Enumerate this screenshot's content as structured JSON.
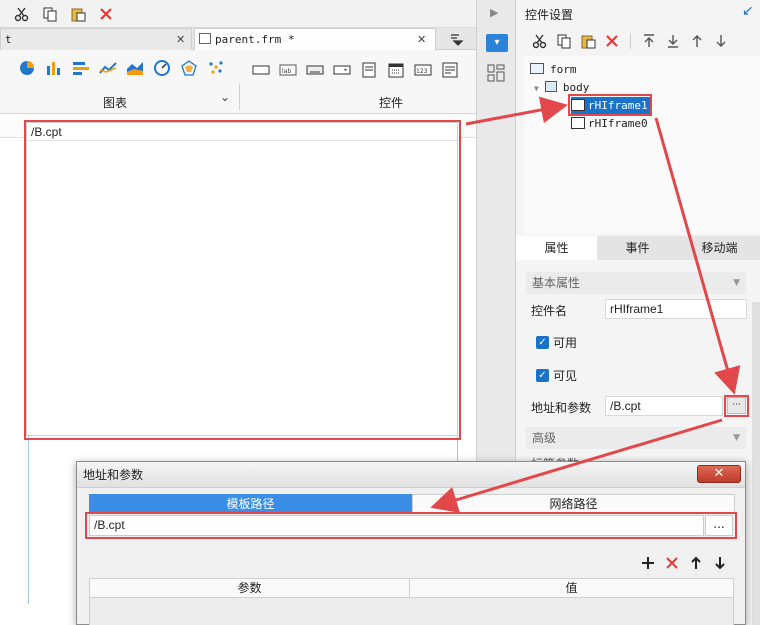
{
  "toolbar": {
    "icons": [
      "scissors-icon",
      "copy-icon",
      "paste-icon",
      "delete-icon"
    ],
    "colors": {
      "delete": "#e53935",
      "icon": "#333333"
    }
  },
  "tabs": [
    {
      "label": "t"
    },
    {
      "label": "parent.frm *"
    }
  ],
  "ribbon": {
    "chart_group_label": "图表",
    "widget_group_label": "控件",
    "widget_icons": [
      "textbox-icon",
      "label-icon",
      "button-icon",
      "combo-icon",
      "listbox-icon",
      "date-icon",
      "number-icon",
      "textarea-icon"
    ]
  },
  "canvas": {
    "iframe_path": "/B.cpt"
  },
  "control_settings": {
    "title": "控件设置",
    "tree": {
      "root": "form",
      "body": "body",
      "children": [
        "rHIframe1",
        "rHIframe0"
      ],
      "selected": "rHIframe1"
    }
  },
  "property_tabs": [
    {
      "label": "属性"
    },
    {
      "label": "事件"
    },
    {
      "label": "移动端"
    }
  ],
  "properties": {
    "basic_section": "基本属性",
    "name_label": "控件名",
    "name_value": "rHIframe1",
    "enabled_label": "可用",
    "visible_label": "可见",
    "url_label": "地址和参数",
    "url_value": "/B.cpt",
    "more_button": "···",
    "advanced_section": "高级",
    "cutoff_label": "标签参数"
  },
  "dialog": {
    "title": "地址和参数",
    "close": "✕",
    "tab_template": "模板路径",
    "tab_network": "网络路径",
    "path_value": "/B.cpt",
    "more_button": "...",
    "col_param": "参数",
    "col_value": "值"
  },
  "accent_colors": {
    "highlight_red": "#e2484b",
    "selection_blue": "#1a73c8",
    "tab_blue": "#3a8ee6"
  }
}
